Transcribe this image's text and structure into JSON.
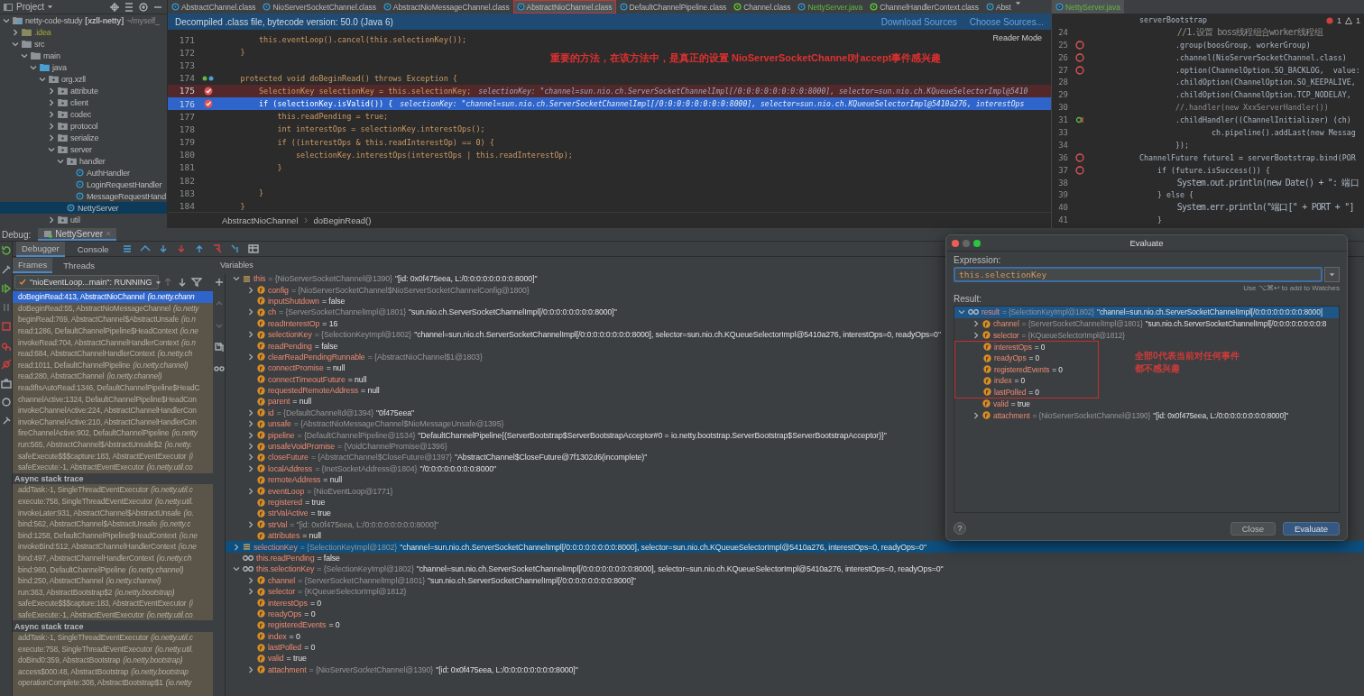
{
  "project": {
    "title": "Project",
    "tree": [
      {
        "label": "netty-code-study",
        "extra": "[xzll-netty]",
        "path": "~/myself_",
        "kind": "module",
        "expanded": true,
        "selected": false,
        "children": [
          {
            "label": ".idea",
            "kind": "folder-ignored",
            "expanded": false,
            "selected": false
          },
          {
            "label": "src",
            "kind": "folder",
            "expanded": true,
            "selected": false,
            "children": [
              {
                "label": "main",
                "kind": "folder",
                "expanded": true,
                "selected": false,
                "children": [
                  {
                    "label": "java",
                    "kind": "folder-source",
                    "expanded": true,
                    "selected": false,
                    "children": [
                      {
                        "label": "org.xzll",
                        "kind": "package",
                        "expanded": true,
                        "selected": false,
                        "children": [
                          {
                            "label": "attribute",
                            "kind": "package",
                            "expanded": false,
                            "selected": false
                          },
                          {
                            "label": "client",
                            "kind": "package",
                            "expanded": false,
                            "selected": false
                          },
                          {
                            "label": "codec",
                            "kind": "package",
                            "expanded": false,
                            "selected": false
                          },
                          {
                            "label": "protocol",
                            "kind": "package",
                            "expanded": false,
                            "selected": false
                          },
                          {
                            "label": "serialize",
                            "kind": "package",
                            "expanded": false,
                            "selected": false
                          },
                          {
                            "label": "server",
                            "kind": "package",
                            "expanded": true,
                            "selected": false,
                            "children": [
                              {
                                "label": "handler",
                                "kind": "package",
                                "expanded": true,
                                "selected": false,
                                "children": [
                                  {
                                    "label": "AuthHandler",
                                    "kind": "class",
                                    "selected": false
                                  },
                                  {
                                    "label": "LoginRequestHandler",
                                    "kind": "class",
                                    "selected": false
                                  },
                                  {
                                    "label": "MessageRequestHand",
                                    "kind": "class",
                                    "selected": false
                                  }
                                ]
                              },
                              {
                                "label": "NettyServer",
                                "kind": "class",
                                "selected": true
                              }
                            ]
                          },
                          {
                            "label": "util",
                            "kind": "package",
                            "expanded": false,
                            "selected": false
                          }
                        ]
                      }
                    ]
                  }
                ]
              }
            ]
          }
        ]
      }
    ]
  },
  "editor": {
    "tabs": [
      {
        "label": "AbstractChannel.class",
        "selected": false,
        "kind": "class"
      },
      {
        "label": "NioServerSocketChannel.class",
        "selected": false,
        "kind": "class"
      },
      {
        "label": "AbstractNioMessageChannel.class",
        "selected": false,
        "kind": "class"
      },
      {
        "label": "AbstractNioChannel.class",
        "selected": true,
        "kind": "class"
      },
      {
        "label": "DefaultChannelPipeline.class",
        "selected": false,
        "kind": "class"
      },
      {
        "label": "Channel.class",
        "selected": false,
        "kind": "interface"
      },
      {
        "label": "NettyServer.java",
        "selected": false,
        "kind": "java"
      },
      {
        "label": "ChannelHandlerContext.class",
        "selected": false,
        "kind": "interface"
      },
      {
        "label": "Abst",
        "selected": false,
        "kind": "class"
      }
    ],
    "banner": {
      "text": "Decompiled .class file, bytecode version: 50.0 (Java 6)",
      "links": [
        "Download Sources",
        "Choose Sources..."
      ]
    },
    "reader_mode": "Reader Mode",
    "annotation": "重要的方法，在该方法中，是真正的设置 NioServerSocketChannel对accept事件感兴趣",
    "lines": [
      {
        "number": "171",
        "code": "        this.eventLoop().cancel(this.selectionKey());",
        "breakpoint": false,
        "current": false
      },
      {
        "number": "172",
        "code": "    }",
        "breakpoint": false,
        "current": false
      },
      {
        "number": "173",
        "breakpoint": false,
        "current": false
      },
      {
        "number": "174",
        "code": "    protected void doBeginRead() throws Exception {",
        "breakpoint": false,
        "current": false,
        "override": true
      },
      {
        "number": "175",
        "code": "        SelectionKey selectionKey = this.selectionKey;",
        "breakpoint": true,
        "current": false,
        "inline_value": "selectionKey: \"channel=sun.nio.ch.ServerSocketChannelImpl[/0:0:0:0:0:0:0:0:8000], selector=sun.nio.ch.KQueueSelectorImpl@5410"
      },
      {
        "number": "176",
        "code": "        if (selectionKey.isValid()) {",
        "breakpoint": true,
        "current": true,
        "inline_value": "selectionKey: \"channel=sun.nio.ch.ServerSocketChannelImpl[/0:0:0:0:0:0:0:0:8000], selector=sun.nio.ch.KQueueSelectorImpl@5410a276, interestOps"
      },
      {
        "number": "177",
        "code": "            this.readPending = true;",
        "breakpoint": false,
        "current": false
      },
      {
        "number": "178",
        "code": "            int interestOps = selectionKey.interestOps();",
        "breakpoint": false,
        "current": false
      },
      {
        "number": "179",
        "code": "            if ((interestOps & this.readInterestOp) == 0) {",
        "breakpoint": false,
        "current": false
      },
      {
        "number": "180",
        "code": "                selectionKey.interestOps(interestOps | this.readInterestOp);",
        "breakpoint": false,
        "current": false
      },
      {
        "number": "181",
        "code": "            }",
        "breakpoint": false,
        "current": false
      },
      {
        "number": "182",
        "breakpoint": false,
        "current": false
      },
      {
        "number": "183",
        "code": "        }",
        "breakpoint": false,
        "current": false
      },
      {
        "number": "184",
        "code": "    }",
        "breakpoint": false,
        "current": false
      }
    ],
    "breadcrumbs": [
      "AbstractNioChannel",
      "doBeginRead()"
    ]
  },
  "side_editor": {
    "tab": "NettyServer.java",
    "problems": [
      "1",
      "1"
    ],
    "lines": [
      {
        "code": "serverBootstrap",
        "comment": false,
        "breakpoint": false
      },
      {
        "number": "24",
        "code": "        //1.设置 boss线程组合worker线程组",
        "comment": true,
        "breakpoint": false
      },
      {
        "number": "25",
        "code": "        .group(boosGroup, workerGroup)",
        "comment": false,
        "breakpoint": true
      },
      {
        "number": "26",
        "code": "        .channel(NioServerSocketChannel.class)",
        "comment": false,
        "breakpoint": true
      },
      {
        "number": "27",
        "code": "        .option(ChannelOption.SO_BACKLOG,  value:",
        "comment": false,
        "breakpoint": true
      },
      {
        "number": "28",
        "code": "        .childOption(ChannelOption.SO_KEEPALIVE,",
        "comment": false,
        "breakpoint": false
      },
      {
        "number": "29",
        "code": "        .childOption(ChannelOption.TCP_NODELAY,",
        "comment": false,
        "breakpoint": false
      },
      {
        "number": "30",
        "code": "        //.handler(new XxxServerHandler())",
        "comment": true,
        "breakpoint": false
      },
      {
        "number": "31",
        "code": "        .childHandler((ChannelInitializer) (ch)",
        "comment": false,
        "breakpoint": false,
        "lambda": true
      },
      {
        "number": "33",
        "code": "                ch.pipeline().addLast(new Messag",
        "comment": false,
        "breakpoint": false
      },
      {
        "number": "34",
        "code": "        });",
        "comment": false,
        "breakpoint": false
      },
      {
        "number": "36",
        "code": "ChannelFuture future1 = serverBootstrap.bind(POR",
        "comment": false,
        "breakpoint": true
      },
      {
        "number": "37",
        "code": "    if (future.isSuccess()) {",
        "comment": false,
        "breakpoint": true
      },
      {
        "number": "38",
        "code": "        System.out.println(new Date() + \": 端口",
        "comment": false,
        "breakpoint": false
      },
      {
        "number": "39",
        "code": "    } else {",
        "comment": false,
        "breakpoint": false
      },
      {
        "number": "40",
        "code": "        System.err.println(\"端口[\" + PORT + \"]",
        "comment": false,
        "breakpoint": false
      },
      {
        "number": "41",
        "code": "    }",
        "comment": false,
        "breakpoint": false
      }
    ]
  },
  "debug": {
    "label": "Debug:",
    "session": "NettyServer",
    "tabs": [
      {
        "label": "Debugger",
        "selected": true
      },
      {
        "label": "Console",
        "selected": false
      }
    ],
    "subtabs": [
      {
        "label": "Frames",
        "selected": true
      },
      {
        "label": "Threads",
        "selected": false
      }
    ],
    "thread": "\"nioEventLoop...main\": RUNNING",
    "frame_groups": [
      {
        "frames": [
          {
            "text": "doBeginRead:413, AbstractNioChannel",
            "package": "(io.netty.chann",
            "selected": true
          },
          {
            "text": "doBeginRead:55, AbstractNioMessageChannel",
            "package": "(io.netty",
            "selected": false
          },
          {
            "text": "beginRead:769, AbstractChannel$AbstractUnsafe",
            "package": "(io.n",
            "selected": false
          },
          {
            "text": "read:1286, DefaultChannelPipeline$HeadContext",
            "package": "(io.ne",
            "selected": false
          },
          {
            "text": "invokeRead:704, AbstractChannelHandlerContext",
            "package": "(io.n",
            "selected": false
          },
          {
            "text": "read:684, AbstractChannelHandlerContext",
            "package": "(io.netty.ch",
            "selected": false
          },
          {
            "text": "read:1011, DefaultChannelPipeline",
            "package": "(io.netty.channel)",
            "selected": false
          },
          {
            "text": "read:280, AbstractChannel",
            "package": "(io.netty.channel)",
            "selected": false
          },
          {
            "text": "readIfIsAutoRead:1346, DefaultChannelPipeline$HeadC",
            "selected": false
          },
          {
            "text": "channelActive:1324, DefaultChannelPipeline$HeadCon",
            "selected": false
          },
          {
            "text": "invokeChannelActive:224, AbstractChannelHandlerCon",
            "selected": false
          },
          {
            "text": "invokeChannelActive:210, AbstractChannelHandlerCon",
            "selected": false
          },
          {
            "text": "fireChannelActive:902, DefaultChannelPipeline",
            "package": "(io.netty",
            "selected": false
          },
          {
            "text": "run:565, AbstractChannel$AbstractUnsafe$2",
            "package": "(io.netty.",
            "selected": false
          },
          {
            "text": "safeExecute$$$capture:183, AbstractEventExecutor",
            "package": "(i",
            "selected": false
          },
          {
            "text": "safeExecute:-1, AbstractEventExecutor",
            "package": "(io.netty.util.co",
            "selected": false
          }
        ]
      },
      {
        "title": "Async stack trace",
        "frames": [
          {
            "text": "addTask:-1, SingleThreadEventExecutor",
            "package": "(io.netty.util.c",
            "selected": false
          },
          {
            "text": "execute:758, SingleThreadEventExecutor",
            "package": "(io.netty.util.",
            "selected": false
          },
          {
            "text": "invokeLater:931, AbstractChannel$AbstractUnsafe",
            "package": "(io.",
            "selected": false
          },
          {
            "text": "bind:562, AbstractChannel$AbstractUnsafe",
            "package": "(io.netty.c",
            "selected": false
          },
          {
            "text": "bind:1258, DefaultChannelPipeline$HeadContext",
            "package": "(io.ne",
            "selected": false
          },
          {
            "text": "invokeBind:512, AbstractChannelHandlerContext",
            "package": "(io.ne",
            "selected": false
          },
          {
            "text": "bind:497, AbstractChannelHandlerContext",
            "package": "(io.netty.ch",
            "selected": false
          },
          {
            "text": "bind:980, DefaultChannelPipeline",
            "package": "(io.netty.channel)",
            "selected": false
          },
          {
            "text": "bind:250, AbstractChannel",
            "package": "(io.netty.channel)",
            "selected": false
          },
          {
            "text": "run:363, AbstractBootstrap$2",
            "package": "(io.netty.bootstrap)",
            "selected": false
          },
          {
            "text": "safeExecute$$$capture:183, AbstractEventExecutor",
            "package": "(i",
            "selected": false
          },
          {
            "text": "safeExecute:-1, AbstractEventExecutor",
            "package": "(io.netty.util.co",
            "selected": false
          }
        ]
      },
      {
        "title": "Async stack trace",
        "frames": [
          {
            "text": "addTask:-1, SingleThreadEventExecutor",
            "package": "(io.netty.util.c",
            "selected": false
          },
          {
            "text": "execute:758, SingleThreadEventExecutor",
            "package": "(io.netty.util.",
            "selected": false
          },
          {
            "text": "doBind0:359, AbstractBootstrap",
            "package": "(io.netty.bootstrap)",
            "selected": false
          },
          {
            "text": "access$000:48, AbstractBootstrap",
            "package": "(io.netty.bootstrap",
            "selected": false
          },
          {
            "text": "operationComplete:308, AbstractBootstrap$1",
            "package": "(io.netty",
            "selected": false
          }
        ]
      }
    ],
    "variables_title": "Variables",
    "variables": [
      {
        "name": "this",
        "type": "= {NioServerSocketChannel@1390}",
        "value": "\"[id: 0x0f475eea, L:/0:0:0:0:0:0:0:0:8000]\"",
        "kind": "object",
        "expanded": true,
        "selected": false,
        "children": [
          {
            "name": "config",
            "type": "= {NioServerSocketChannel$NioServerSocketChannelConfig@1800}",
            "kind": "field",
            "expanded": false
          },
          {
            "name": "inputShutdown",
            "value": "= false",
            "kind": "field"
          },
          {
            "name": "ch",
            "type": "= {ServerSocketChannelImpl@1801}",
            "value": "\"sun.nio.ch.ServerSocketChannelImpl[/0:0:0:0:0:0:0:0:8000]\"",
            "kind": "field",
            "expanded": false
          },
          {
            "name": "readInterestOp",
            "value": "= 16",
            "kind": "field"
          },
          {
            "name": "selectionKey",
            "type": "= {SelectionKeyImpl@1802}",
            "value": "\"channel=sun.nio.ch.ServerSocketChannelImpl[/0:0:0:0:0:0:0:0:8000], selector=sun.nio.ch.KQueueSelectorImpl@5410a276, interestOps=0, readyOps=0\"",
            "kind": "field",
            "expanded": false
          },
          {
            "name": "readPending",
            "value": "= false",
            "kind": "field"
          },
          {
            "name": "clearReadPendingRunnable",
            "type": "= {AbstractNioChannel$1@1803}",
            "kind": "field",
            "expanded": false
          },
          {
            "name": "connectPromise",
            "value": "= null",
            "kind": "field"
          },
          {
            "name": "connectTimeoutFuture",
            "value": "= null",
            "kind": "field"
          },
          {
            "name": "requestedRemoteAddress",
            "value": "= null",
            "kind": "field"
          },
          {
            "name": "parent",
            "value": "= null",
            "kind": "field"
          },
          {
            "name": "id",
            "type": "= {DefaultChannelId@1394}",
            "value": "\"0f475eea\"",
            "kind": "field",
            "expanded": false
          },
          {
            "name": "unsafe",
            "type": "= {AbstractNioMessageChannel$NioMessageUnsafe@1395}",
            "kind": "field",
            "expanded": false
          },
          {
            "name": "pipeline",
            "type": "= {DefaultChannelPipeline@1534}",
            "value": "\"DefaultChannelPipeline{(ServerBootstrap$ServerBootstrapAcceptor#0 = io.netty.bootstrap.ServerBootstrap$ServerBootstrapAcceptor)}\"",
            "kind": "field",
            "expanded": false
          },
          {
            "name": "unsafeVoidPromise",
            "type": "= {VoidChannelPromise@1396}",
            "kind": "field",
            "expanded": false
          },
          {
            "name": "closeFuture",
            "type": "= {AbstractChannel$CloseFuture@1397}",
            "value": "\"AbstractChannel$CloseFuture@7f1302d6(incomplete)\"",
            "kind": "field",
            "expanded": false
          },
          {
            "name": "localAddress",
            "type": "= {InetSocketAddress@1804}",
            "value": "\"/0:0:0:0:0:0:0:0:8000\"",
            "kind": "field",
            "expanded": false
          },
          {
            "name": "remoteAddress",
            "value": "= null",
            "kind": "field"
          },
          {
            "name": "eventLoop",
            "type": "= {NioEventLoop@1771}",
            "kind": "field",
            "expanded": false
          },
          {
            "name": "registered",
            "value": "= true",
            "kind": "field"
          },
          {
            "name": "strValActive",
            "value": "= true",
            "kind": "field"
          },
          {
            "name": "strVal",
            "type": "= \"[id: 0x0f475eea, L:/0:0:0:0:0:0:0:0:8000]\"",
            "kind": "field",
            "expanded": false
          },
          {
            "name": "attributes",
            "value": "= null",
            "kind": "field"
          }
        ]
      },
      {
        "name": "selectionKey",
        "type": "= {SelectionKeyImpl@1802}",
        "value": "\"channel=sun.nio.ch.ServerSocketChannelImpl[/0:0:0:0:0:0:0:0:8000], selector=sun.nio.ch.KQueueSelectorImpl@5410a276, interestOps=0, readyOps=0\"",
        "kind": "object",
        "expanded": false,
        "selected": true
      },
      {
        "name": "this.readPending",
        "value": "= false",
        "kind": "watch",
        "selected": false
      },
      {
        "name": "this.selectionKey",
        "type": "= {SelectionKeyImpl@1802}",
        "value": "\"channel=sun.nio.ch.ServerSocketChannelImpl[/0:0:0:0:0:0:0:0:8000], selector=sun.nio.ch.KQueueSelectorImpl@5410a276, interestOps=0, readyOps=0\"",
        "kind": "watch",
        "expanded": true,
        "selected": false,
        "children": [
          {
            "name": "channel",
            "type": "= {ServerSocketChannelImpl@1801}",
            "value": "\"sun.nio.ch.ServerSocketChannelImpl[/0:0:0:0:0:0:0:0:8000]\"",
            "kind": "field",
            "expanded": false
          },
          {
            "name": "selector",
            "type": "= {KQueueSelectorImpl@1812}",
            "kind": "field",
            "expanded": false
          },
          {
            "name": "interestOps",
            "value": "= 0",
            "kind": "field"
          },
          {
            "name": "readyOps",
            "value": "= 0",
            "kind": "field"
          },
          {
            "name": "registeredEvents",
            "value": "= 0",
            "kind": "field"
          },
          {
            "name": "index",
            "value": "= 0",
            "kind": "field"
          },
          {
            "name": "lastPolled",
            "value": "= 0",
            "kind": "field"
          },
          {
            "name": "valid",
            "value": "= true",
            "kind": "field"
          },
          {
            "name": "attachment",
            "type": "= {NioServerSocketChannel@1390}",
            "value": "\"[id: 0x0f475eea, L:/0:0:0:0:0:0:0:0:8000]\"",
            "kind": "field",
            "expanded": false
          }
        ]
      }
    ]
  },
  "evaluate": {
    "title": "Evaluate",
    "expression_label": "Expression:",
    "expression": "this.selectionKey",
    "hint": "Use ⌥⌘↩ to add to Watches",
    "result_label": "Result:",
    "result": {
      "name": "result",
      "type": "= {SelectionKeyImpl@1802}",
      "value": "\"channel=sun.nio.ch.ServerSocketChannelImpl[/0:0:0:0:0:0:0:0:8000]",
      "kind": "watch",
      "expanded": true,
      "selected": true,
      "children": [
        {
          "name": "channel",
          "type": "= {ServerSocketChannelImpl@1801}",
          "value": "\"sun.nio.ch.ServerSocketChannelImpl[/0:0:0:0:0:0:0:0:8",
          "kind": "field",
          "expanded": false
        },
        {
          "name": "selector",
          "type": "= {KQueueSelectorImpl@1812}",
          "kind": "field",
          "expanded": false
        },
        {
          "name": "interestOps",
          "value": "= 0",
          "kind": "field",
          "boxed": true
        },
        {
          "name": "readyOps",
          "value": "= 0",
          "kind": "field",
          "boxed": true
        },
        {
          "name": "registeredEvents",
          "value": "= 0",
          "kind": "field",
          "boxed": true
        },
        {
          "name": "index",
          "value": "= 0",
          "kind": "field",
          "boxed": true
        },
        {
          "name": "lastPolled",
          "value": "= 0",
          "kind": "field",
          "boxed": true
        },
        {
          "name": "valid",
          "value": "= true",
          "kind": "field"
        },
        {
          "name": "attachment",
          "type": "= {NioServerSocketChannel@1390}",
          "value": "\"[id: 0x0f475eea, L:/0:0:0:0:0:0:0:0:8000]\"",
          "kind": "field",
          "expanded": false
        }
      ]
    },
    "annotation": [
      "全部0代表当前对任何事件",
      "都不感兴趣"
    ],
    "help": "?",
    "buttons": [
      {
        "label": "Close",
        "kind": "secondary"
      },
      {
        "label": "Evaluate",
        "kind": "primary"
      }
    ]
  }
}
